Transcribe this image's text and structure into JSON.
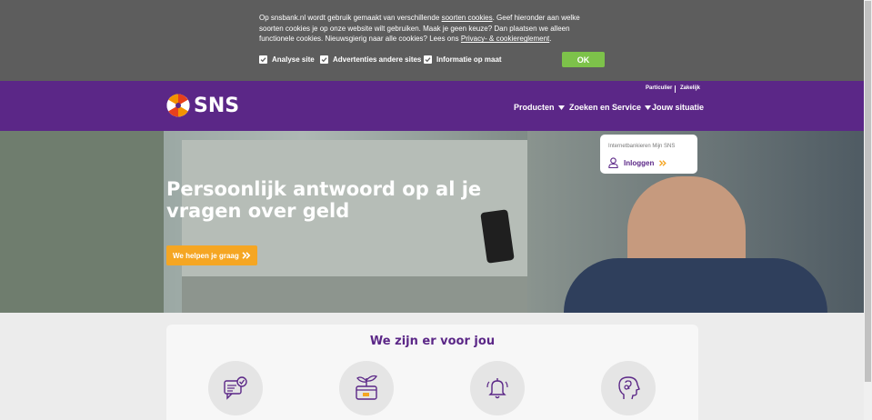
{
  "cookie_bar": {
    "text_part1": "Op snsbank.nl wordt gebruik gemaakt van verschillende ",
    "link_cookie_types": "soorten cookies",
    "text_part2": ". Geef hieronder aan welke soorten cookies je op onze website wilt gebruiken. Maak je geen keuze? Dan plaatsen we alleen functionele cookies. Nieuwsgierig naar alle cookies? Lees ons ",
    "link_privacy": "Privacy- & cookiereglement",
    "text_part3": ".",
    "checkboxes": [
      {
        "label": "Analyse site",
        "checked": true
      },
      {
        "label": "Advertenties andere sites",
        "checked": true
      },
      {
        "label": "Informatie op maat",
        "checked": true
      }
    ],
    "ok_label": "OK"
  },
  "header": {
    "top_links": [
      "Particulier",
      "Zakelijk"
    ],
    "logo_text": "SNS",
    "nav": [
      {
        "label": "Producten",
        "dropdown": true
      },
      {
        "label": "Zoeken en Service",
        "dropdown": true
      },
      {
        "label": "Jouw situatie",
        "dropdown": false
      }
    ]
  },
  "hero": {
    "title": "Persoonlijk antwoord op al je vragen over geld",
    "cta_label": "We helpen je graag",
    "login_card": {
      "title": "Internetbankieren Mijn SNS",
      "login_label": "Inloggen"
    }
  },
  "service": {
    "title": "We zijn er voor jou",
    "icons": [
      "chat-check-icon",
      "plant-card-icon",
      "bell-icon",
      "head-icon"
    ]
  },
  "colors": {
    "purple": "#5b2787",
    "orange": "#f5a623",
    "green": "#7dc24a",
    "cookie_bg": "#5d5d5d"
  }
}
